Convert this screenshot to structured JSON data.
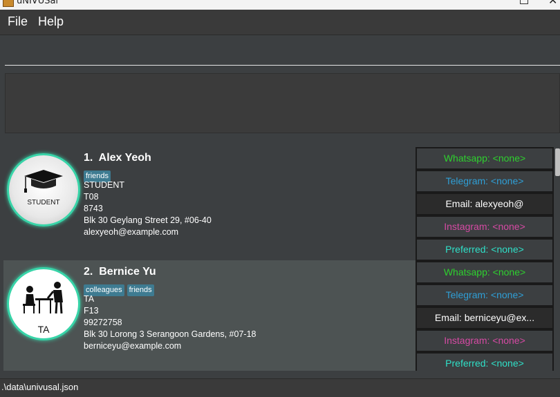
{
  "window": {
    "title": "uNIVUSal"
  },
  "menu": {
    "file": "File",
    "help": "Help"
  },
  "command_box": {
    "value": ""
  },
  "result_display": {
    "text": ""
  },
  "persons": [
    {
      "index": "1.",
      "name": "Alex Yeoh",
      "avatar_label": "STUDENT",
      "tags": [
        "friends"
      ],
      "role": "STUDENT",
      "group": "T08",
      "phone": "8743",
      "address": "Blk 30 Geylang Street 29, #06-40",
      "email": "alexyeoh@example.com",
      "contacts": {
        "whatsapp": "Whatsapp: <none>",
        "telegram": "Telegram: <none>",
        "email": "Email: alexyeoh@",
        "instagram": "Instagram: <none>",
        "preferred": "Preferred: <none>"
      }
    },
    {
      "index": "2.",
      "name": "Bernice Yu",
      "avatar_label": "TA",
      "tags": [
        "colleagues",
        "friends"
      ],
      "role": "TA",
      "group": "F13",
      "phone": "99272758",
      "address": "Blk 30 Lorong 3 Serangoon Gardens, #07-18",
      "email": "berniceyu@example.com",
      "contacts": {
        "whatsapp": "Whatsapp: <none>",
        "telegram": "Telegram: <none>",
        "email": "Email: berniceyu@ex...",
        "instagram": "Instagram: <none>",
        "preferred": "Preferred: <none>"
      }
    }
  ],
  "status_bar": {
    "path": ".\\data\\univusal.json"
  },
  "colors": {
    "whatsapp": "#2ed12e",
    "telegram": "#2f9fd6",
    "email": "#ffffff",
    "instagram": "#d64aa4",
    "preferred": "#2fe0c8",
    "tag_bg": "#3e7b91",
    "avatar_ring": "#38d4a8"
  }
}
